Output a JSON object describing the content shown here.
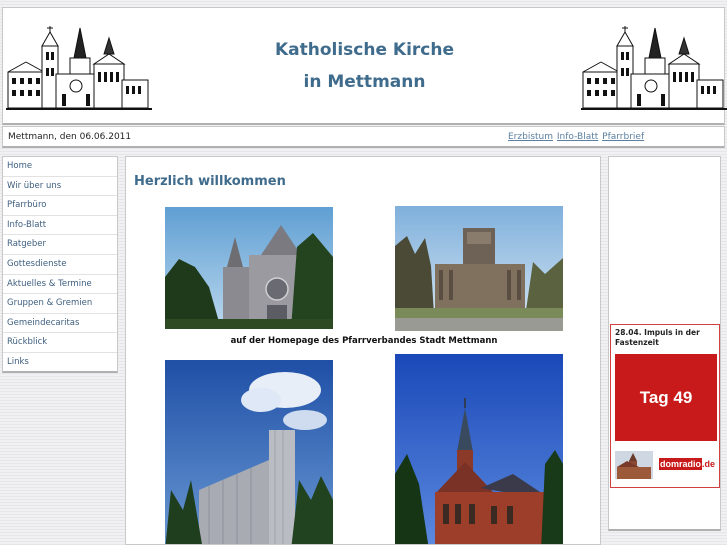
{
  "header": {
    "title_line1": "Katholische Kirche",
    "title_line2": "in Mettmann"
  },
  "infobar": {
    "date": "Mettmann, den 06.06.2011",
    "links": [
      "Erzbistum",
      "Info-Blatt",
      "Pfarrbrief"
    ]
  },
  "sidebar": {
    "items": [
      {
        "label": "Home"
      },
      {
        "label": "Wir über uns"
      },
      {
        "label": "Pfarrbüro"
      },
      {
        "label": "Info-Blatt"
      },
      {
        "label": "Ratgeber"
      },
      {
        "label": "Gottesdienste"
      },
      {
        "label": "Aktuelles & Termine"
      },
      {
        "label": "Gruppen & Gremien"
      },
      {
        "label": "Gemeindecaritas"
      },
      {
        "label": "Rückblick"
      },
      {
        "label": "Links"
      }
    ]
  },
  "main": {
    "heading": "Herzlich willkommen",
    "caption": "auf der Homepage des Pfarrverbandes Stadt Mettmann"
  },
  "promo": {
    "title": "28.04. Impuls in der Fastenzeit",
    "box_text": "Tag 49",
    "brand_dom": "domradio",
    "brand_de": ".de"
  },
  "colors": {
    "title_blue": "#3f6b8c",
    "link_blue": "#5b7fa0",
    "promo_red": "#c81a1a"
  }
}
